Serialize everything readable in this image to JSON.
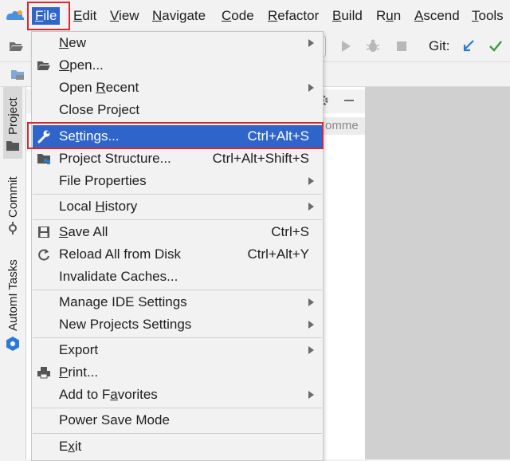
{
  "menubar": {
    "items": [
      {
        "pre": "",
        "mn": "F",
        "post": "ile"
      },
      {
        "pre": "",
        "mn": "E",
        "post": "dit"
      },
      {
        "pre": "",
        "mn": "V",
        "post": "iew"
      },
      {
        "pre": "",
        "mn": "N",
        "post": "avigate"
      },
      {
        "pre": "",
        "mn": "C",
        "post": "ode"
      },
      {
        "pre": "",
        "mn": "R",
        "post": "efactor"
      },
      {
        "pre": "",
        "mn": "B",
        "post": "uild"
      },
      {
        "pre": "R",
        "mn": "u",
        "post": "n"
      },
      {
        "pre": "",
        "mn": "A",
        "post": "scend"
      },
      {
        "pre": "",
        "mn": "T",
        "post": "ools"
      }
    ]
  },
  "toolbar": {
    "git_label": "Git:"
  },
  "panel": {
    "column_header_partial": "omme"
  },
  "left_strip": {
    "tabs": [
      {
        "label": "Project"
      },
      {
        "label": "Commit"
      },
      {
        "label": "AutomI Tasks"
      }
    ]
  },
  "file_menu": {
    "items": [
      {
        "pre": "",
        "mn": "N",
        "post": "ew",
        "shortcut": "",
        "submenu": true
      },
      {
        "pre": "",
        "mn": "O",
        "post": "pen...",
        "shortcut": "",
        "submenu": false
      },
      {
        "pre": "Open ",
        "mn": "R",
        "post": "ecent",
        "shortcut": "",
        "submenu": true
      },
      {
        "pre": "Close Project",
        "mn": "",
        "post": "",
        "shortcut": "",
        "submenu": false
      },
      {
        "pre": "Se",
        "mn": "t",
        "post": "tings...",
        "shortcut": "Ctrl+Alt+S",
        "submenu": false
      },
      {
        "pre": "Project Structure...",
        "mn": "",
        "post": "",
        "shortcut": "Ctrl+Alt+Shift+S",
        "submenu": false
      },
      {
        "pre": "File Properties",
        "mn": "",
        "post": "",
        "shortcut": "",
        "submenu": true
      },
      {
        "pre": "Local ",
        "mn": "H",
        "post": "istory",
        "shortcut": "",
        "submenu": true
      },
      {
        "pre": "",
        "mn": "S",
        "post": "ave All",
        "shortcut": "Ctrl+S",
        "submenu": false
      },
      {
        "pre": "Reload All from Disk",
        "mn": "",
        "post": "",
        "shortcut": "Ctrl+Alt+Y",
        "submenu": false
      },
      {
        "pre": "Invalidate Caches...",
        "mn": "",
        "post": "",
        "shortcut": "",
        "submenu": false
      },
      {
        "pre": "Manage IDE Settings",
        "mn": "",
        "post": "",
        "shortcut": "",
        "submenu": true
      },
      {
        "pre": "New Projects Settings",
        "mn": "",
        "post": "",
        "shortcut": "",
        "submenu": true
      },
      {
        "pre": "Export",
        "mn": "",
        "post": "",
        "shortcut": "",
        "submenu": true
      },
      {
        "pre": "",
        "mn": "P",
        "post": "rint...",
        "shortcut": "",
        "submenu": false
      },
      {
        "pre": "Add to F",
        "mn": "a",
        "post": "vorites",
        "shortcut": "",
        "submenu": true
      },
      {
        "pre": "Power Save Mode",
        "mn": "",
        "post": "",
        "shortcut": "",
        "submenu": false
      },
      {
        "pre": "E",
        "mn": "x",
        "post": "it",
        "shortcut": "",
        "submenu": false
      }
    ],
    "selected_index": 4
  },
  "colors": {
    "selection": "#2f65ca",
    "highlight_border": "#d9282f",
    "accent_green": "#3d9a3d",
    "accent_blue": "#2b7bd3"
  }
}
